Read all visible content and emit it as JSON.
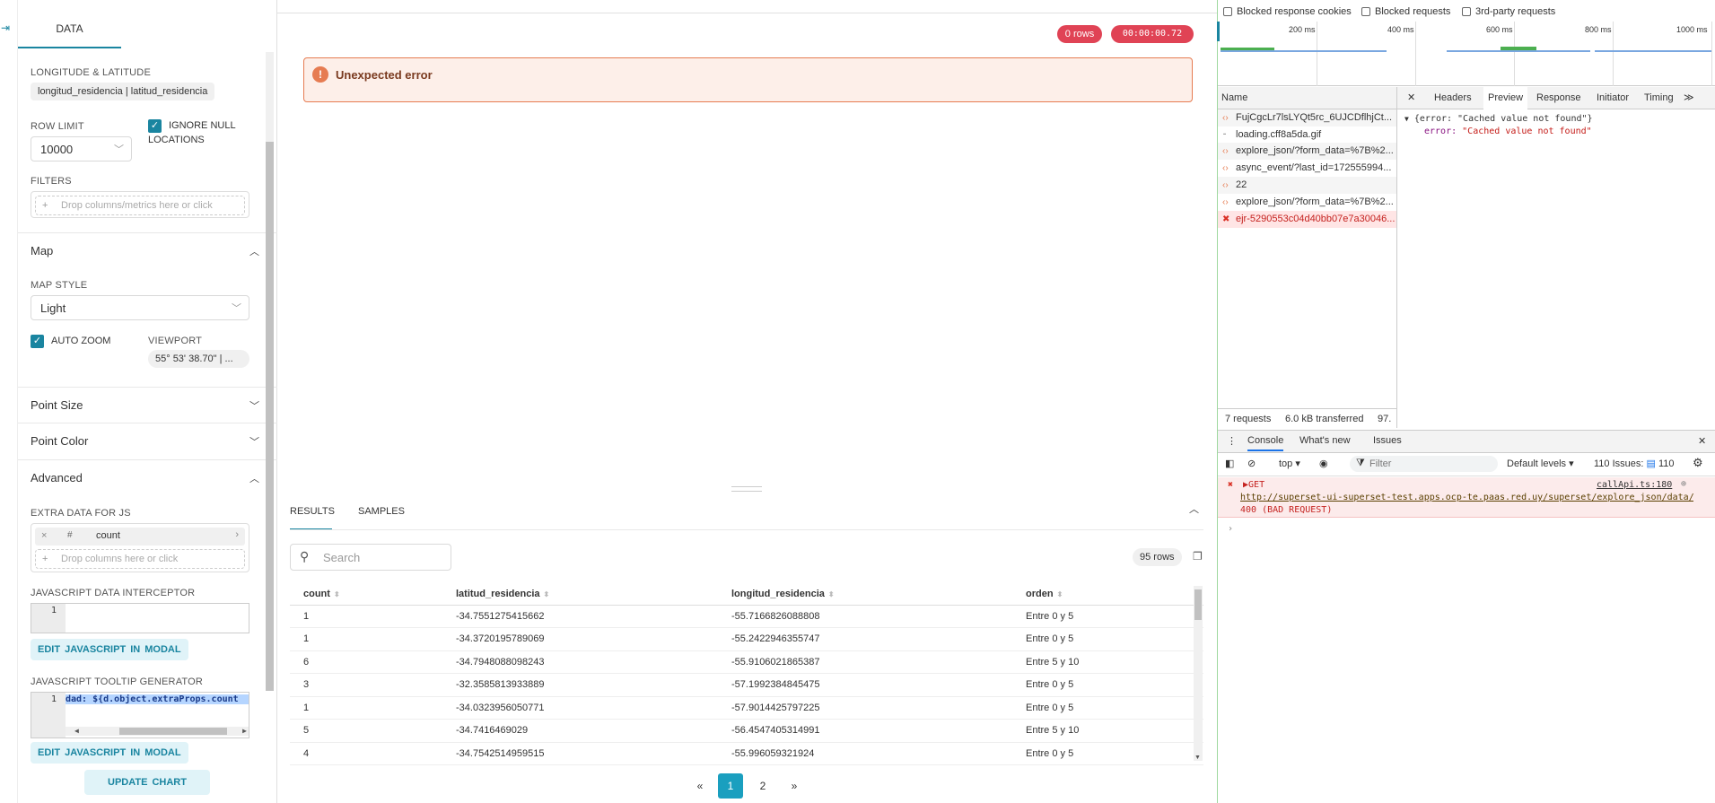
{
  "control_panel": {
    "tab": "DATA",
    "lonlat_label": "LONGITUDE & LATITUDE",
    "lonlat_value": "longitud_residencia | latitud_residencia",
    "row_limit_label": "ROW LIMIT",
    "row_limit_value": "10000",
    "ignore_null_label_1": "IGNORE NULL",
    "ignore_null_label_2": "LOCATIONS",
    "filters_label": "FILTERS",
    "filters_placeholder": "Drop columns/metrics here or click",
    "map_section": "Map",
    "map_style_label": "MAP STYLE",
    "map_style_value": "Light",
    "auto_zoom_label": "AUTO ZOOM",
    "viewport_label": "VIEWPORT",
    "viewport_value": "55° 53' 38.70\" | ...",
    "point_size_section": "Point Size",
    "point_color_section": "Point Color",
    "advanced_section": "Advanced",
    "extra_data_label": "EXTRA DATA FOR JS",
    "extra_data_item": "count",
    "extra_data_placeholder": "Drop columns here or click",
    "js_interceptor_label": "JAVASCRIPT DATA INTERCEPTOR",
    "js_interceptor_line": "1",
    "edit_js_button": "EDIT  JAVASCRIPT  IN MODAL",
    "js_tooltip_label": "JAVASCRIPT TOOLTIP GENERATOR",
    "js_tooltip_line": "1",
    "js_tooltip_code": "dad: ${d.object.extraProps.count",
    "edit_js_button_2": "EDIT  JAVASCRIPT  IN MODAL",
    "update_chart_button": "UPDATE CHART"
  },
  "main": {
    "rows_badge": "0 rows",
    "timer_badge": "00:00:00.72",
    "error_message": "Unexpected error",
    "tabs": [
      "RESULTS",
      "SAMPLES"
    ],
    "search_placeholder": "Search",
    "row_count": "95 rows",
    "columns": [
      "count",
      "latitud_residencia",
      "longitud_residencia",
      "orden"
    ],
    "rows": [
      [
        "1",
        "-34.7551275415662",
        "-55.7166826088808",
        "Entre 0 y 5"
      ],
      [
        "1",
        "-34.3720195789069",
        "-55.2422946355747",
        "Entre 0 y 5"
      ],
      [
        "6",
        "-34.7948088098243",
        "-55.9106021865387",
        "Entre 5 y 10"
      ],
      [
        "3",
        "-32.3585813933889",
        "-57.1992384845475",
        "Entre 0 y 5"
      ],
      [
        "1",
        "-34.0323956050771",
        "-57.9014425797225",
        "Entre 0 y 5"
      ],
      [
        "5",
        "-34.7416469029",
        "-56.4547405314991",
        "Entre 5 y 10"
      ],
      [
        "4",
        "-34.7542514959515",
        "-55.996059321924",
        "Entre 0 y 5"
      ]
    ],
    "pagination": [
      "«",
      "1",
      "2",
      "»"
    ]
  },
  "devtools": {
    "filter_checkboxes": [
      "Blocked response cookies",
      "Blocked requests",
      "3rd-party requests"
    ],
    "timeline_ticks": [
      "200 ms",
      "400 ms",
      "600 ms",
      "800 ms",
      "1000 ms"
    ],
    "name_header": "Name",
    "requests": [
      "FujCgcLr7lsLYQt5rc_6UJCDflhjCt...",
      "loading.cff8a5da.gif",
      "explore_json/?form_data=%7B%2...",
      "async_event/?last_id=172555994...",
      "22",
      "explore_json/?form_data=%7B%2...",
      "ejr-5290553c04d40bb07e7a30046..."
    ],
    "detail_tabs": [
      "Headers",
      "Preview",
      "Response",
      "Initiator",
      "Timing"
    ],
    "preview_line_1": "{error: \"Cached value not found\"}",
    "preview_key": "error:",
    "preview_value": "\"Cached value not found\"",
    "status_requests": "7 requests",
    "status_transferred": "6.0 kB transferred",
    "status_more": "97.",
    "drawer_tabs": [
      "Console",
      "What's new",
      "Issues"
    ],
    "context": "top",
    "filter_placeholder": "Filter",
    "levels": "Default levels",
    "issues_count": "110 Issues:",
    "issues_num": "110",
    "console_method": "GET",
    "console_source": "callApi.ts:180",
    "console_url": "http://superset-ui-superset-test.apps.ocp-te.paas.red.uy/superset/explore_json/data/…",
    "console_status": "400 (BAD REQUEST)"
  }
}
